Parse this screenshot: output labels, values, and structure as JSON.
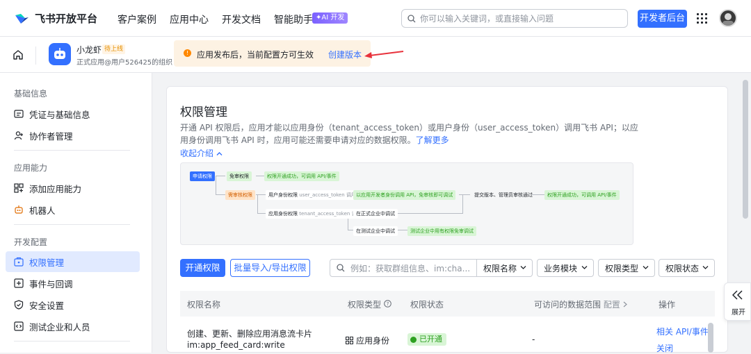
{
  "topnav": {
    "logo_text": "飞书开放平台",
    "items": [
      "客户案例",
      "应用中心",
      "开发文档",
      "智能助手"
    ],
    "ai_badge": "✦AI 开发",
    "search_placeholder": "你可以输入关键词，或直接输入问题",
    "dev_console": "开发者后台"
  },
  "subbar": {
    "app_name": "小龙虾",
    "app_status": "待上线",
    "app_sub": "正式应用@用户526425的组织",
    "notice_text": "应用发布后，当前配置方可生效",
    "notice_link": "创建版本"
  },
  "sidebar": {
    "groups": [
      {
        "title": "基础信息",
        "items": [
          "凭证与基础信息",
          "协作者管理"
        ]
      },
      {
        "title": "应用能力",
        "items": [
          "添加应用能力",
          "机器人"
        ]
      },
      {
        "title": "开发配置",
        "items": [
          "权限管理",
          "事件与回调",
          "安全设置",
          "测试企业和人员"
        ]
      }
    ]
  },
  "main": {
    "title": "权限管理",
    "description": "开通 API 权限后，应用才能以应用身份（tenant_access_token）或用户身份（user_access_token）调用飞书 API；以应用身份调用飞书 API 时，应用可能还需要申请对应的数据权限。",
    "learn_more": "了解更多",
    "collapse": "收起介绍",
    "diagram": {
      "apply": "申请权限",
      "free": "免审权限",
      "free_result": "权限开通成功，可调用 API/事件",
      "need_review": "需审核权限",
      "user_identity": "用户身份权限",
      "user_token": "user_access_token 调用",
      "user_result": "以应用开发者身份调用 API，免审核即可调试",
      "submit": "提交版本、管理员审核通过",
      "final_result": "权限开通成功，可调用 API/事件",
      "app_identity": "应用身份权限",
      "app_token": "tenant_access_token 调用",
      "prod_debug": "在正式企业中调试",
      "test_debug": "在测试企业中调试",
      "test_result": "测试企业中用有权限免审调试"
    },
    "buttons": {
      "enable": "开通权限",
      "import_export": "批量导入/导出权限"
    },
    "filter_placeholder": "例如：获取群组信息、im:cha...",
    "filters": [
      "权限名称",
      "业务模块",
      "权限类型",
      "权限状态"
    ],
    "table": {
      "headers": [
        "权限名称",
        "权限类型",
        "权限状态",
        "可访问的数据范围",
        "配置",
        "操作"
      ],
      "rows": [
        {
          "name": "创建、更新、删除应用消息流卡片",
          "code": "im:app_feed_card:write",
          "type": "应用身份",
          "status": "已开通",
          "scope": "-",
          "action1": "相关 API/事件",
          "action2": "关闭"
        }
      ]
    }
  },
  "expand_label": "展开",
  "colors": {
    "primary": "#3370ff",
    "success": "#2ea121",
    "warning": "#ff8800"
  }
}
